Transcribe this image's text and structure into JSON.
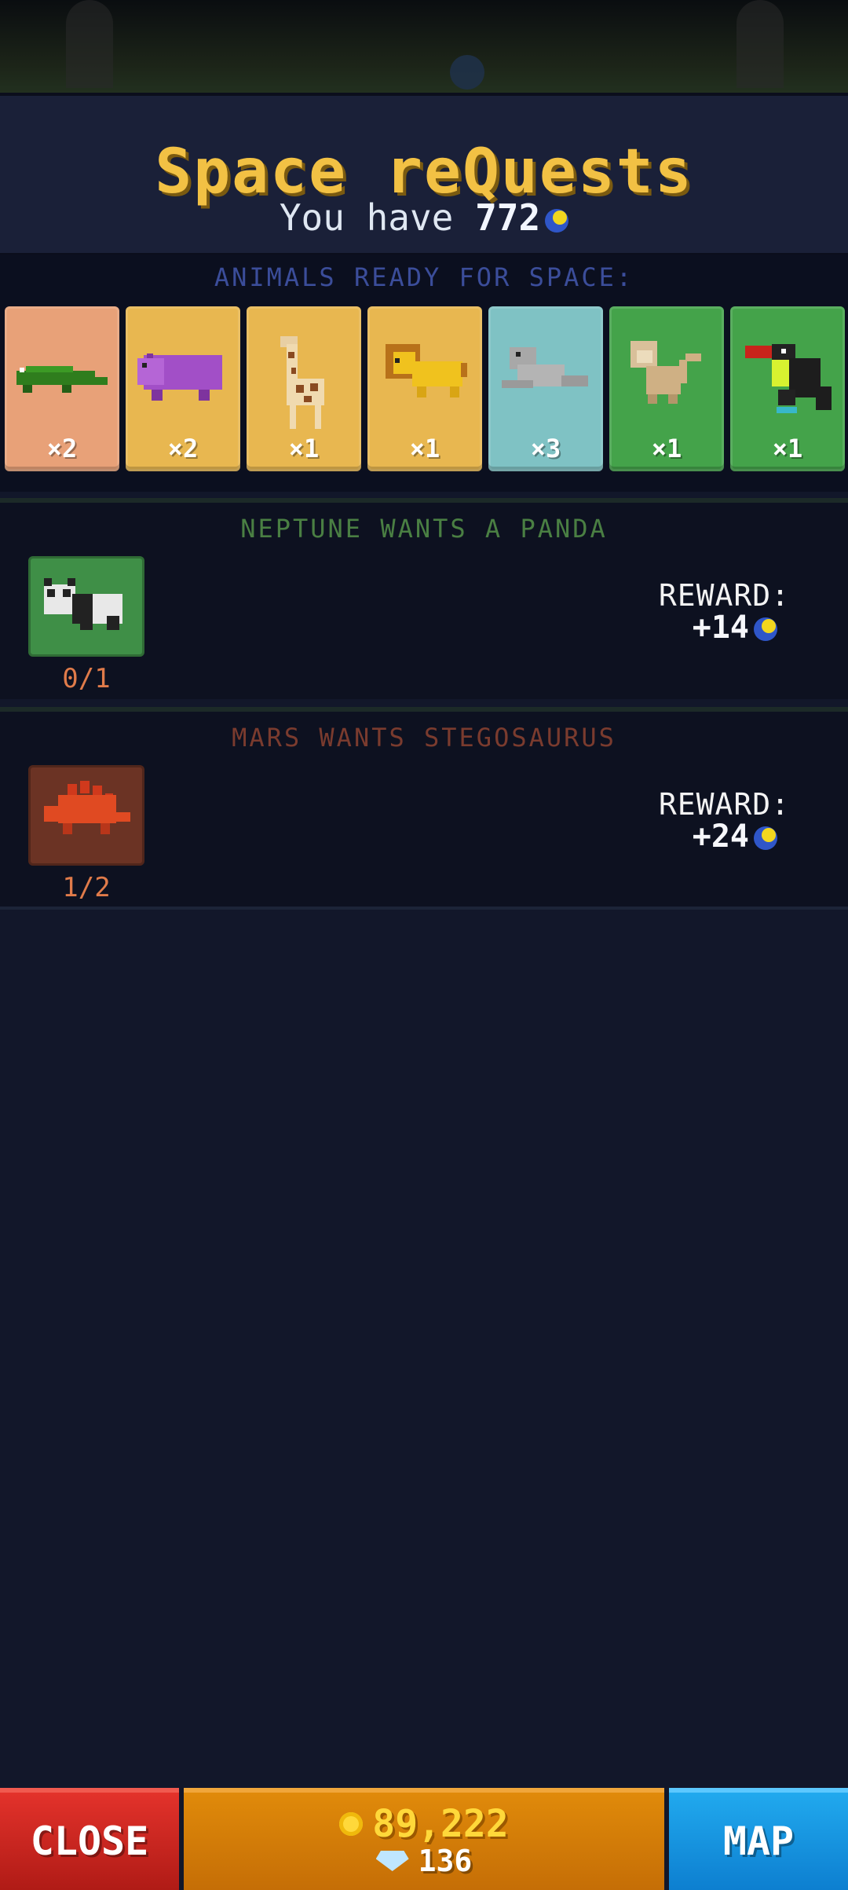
{
  "header": {
    "title": "Space reQuests",
    "balance_prefix": "You have",
    "balance_value": "772",
    "balance_icon": "moon-coin-icon"
  },
  "ready": {
    "label": "ANIMALS READY FOR SPACE:",
    "animals": [
      {
        "name": "crocodile",
        "icon": "crocodile-icon",
        "count": "×2",
        "bg": "#e8a178"
      },
      {
        "name": "hippo",
        "icon": "hippo-icon",
        "count": "×2",
        "bg": "#e8b750"
      },
      {
        "name": "giraffe",
        "icon": "giraffe-icon",
        "count": "×1",
        "bg": "#e8b750"
      },
      {
        "name": "lion",
        "icon": "lion-icon",
        "count": "×1",
        "bg": "#e8b750"
      },
      {
        "name": "seal",
        "icon": "seal-icon",
        "count": "×3",
        "bg": "#7fc2c4"
      },
      {
        "name": "monkey",
        "icon": "monkey-icon",
        "count": "×1",
        "bg": "#44a34a"
      },
      {
        "name": "toucan",
        "icon": "toucan-icon",
        "count": "×1",
        "bg": "#44a34a"
      }
    ]
  },
  "requests": [
    {
      "title": "NEPTUNE WANTS A PANDA",
      "title_color": "#4a7f43",
      "animal_icon": "panda-icon",
      "tile_bg": "#3f8f47",
      "progress": "0/1",
      "reward_label": "REWARD:",
      "reward_value": "+14",
      "reward_icon": "moon-coin-icon"
    },
    {
      "title": "MARS WANTS STEGOSAURUS",
      "title_color": "#7a3b2e",
      "animal_icon": "stegosaurus-icon",
      "tile_bg": "#6b3324",
      "progress": "1/2",
      "reward_label": "REWARD:",
      "reward_value": "+24",
      "reward_icon": "moon-coin-icon"
    }
  ],
  "bottom": {
    "close_label": "CLOSE",
    "coins": "89,222",
    "gems": "136",
    "map_label": "MAP"
  }
}
